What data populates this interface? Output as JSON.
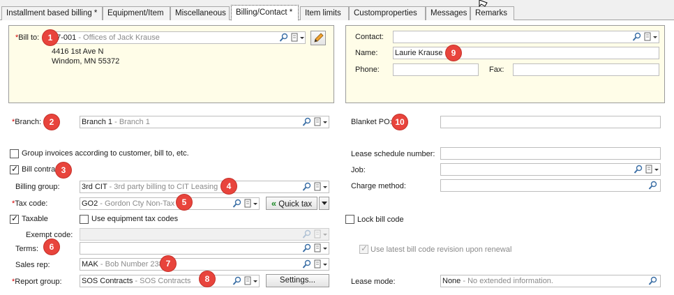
{
  "tabs": [
    {
      "label": "Installment based billing *"
    },
    {
      "label": "Equipment/Item"
    },
    {
      "label": "Miscellaneous"
    },
    {
      "label": "Billing/Contact *"
    },
    {
      "label": "Item limits"
    },
    {
      "label": "Customproperties"
    },
    {
      "label": "Messages"
    },
    {
      "label": "Remarks"
    }
  ],
  "bill_to": {
    "required_mark": "*",
    "label": "Bill to:",
    "code": "07-001",
    "separator": " - ",
    "desc": "Offices of Jack Krause",
    "address_line1": "4416 1st Ave N",
    "address_line2": "Windom, MN 55372"
  },
  "contact": {
    "contact_label": "Contact:",
    "contact_value": "",
    "name_label": "Name:",
    "name_value": "Laurie Krause",
    "phone_label": "Phone:",
    "phone_value": "",
    "fax_label": "Fax:",
    "fax_value": ""
  },
  "left": {
    "branch": {
      "req": "*",
      "label": "Branch:",
      "code": "Branch 1",
      "sep": " - ",
      "desc": "Branch 1"
    },
    "group_invoices": {
      "label": "Group invoices according to customer, bill to, etc.",
      "checked": false
    },
    "bill_contract": {
      "label": "Bill contract",
      "checked": true
    },
    "billing_group": {
      "label": "Billing group:",
      "code": "3rd CIT",
      "sep": " - ",
      "desc": "3rd party billing to CIT Leasing"
    },
    "tax_code": {
      "req": "*",
      "label": "Tax code:",
      "code": "GO2",
      "sep": " - ",
      "desc": "Gordon Cty Non-Tax"
    },
    "quick_tax": "Quick tax",
    "taxable": {
      "label": "Taxable",
      "checked": true
    },
    "use_equipment_tax": {
      "label": "Use equipment tax codes",
      "checked": false
    },
    "exempt_code": {
      "label": "Exempt code:"
    },
    "terms": {
      "label": "Terms:",
      "value": ""
    },
    "sales_rep": {
      "label": "Sales rep:",
      "code": "MAK",
      "sep": " - ",
      "desc": "Bob Number 238"
    },
    "report_group": {
      "req": "*",
      "label": "Report group:",
      "code": "SOS Contracts",
      "sep": " - ",
      "desc": "SOS Contracts"
    },
    "settings_button": "Settings..."
  },
  "right": {
    "blanket_po": {
      "label": "Blanket PO:",
      "value": ""
    },
    "lease_schedule": {
      "label": "Lease schedule number:",
      "value": ""
    },
    "job": {
      "label": "Job:",
      "value": ""
    },
    "charge_method": {
      "label": "Charge method:",
      "value": ""
    },
    "lock_bill_code": {
      "label": "Lock bill code",
      "checked": false
    },
    "use_latest": {
      "label": "Use latest bill code revision upon renewal",
      "checked": true
    },
    "lease_mode": {
      "label": "Lease mode:",
      "code": "None",
      "sep": " - ",
      "desc": "No extended information."
    }
  },
  "badges": [
    "1",
    "2",
    "3",
    "4",
    "5",
    "6",
    "7",
    "8",
    "9",
    "10"
  ],
  "colors": {
    "badge": "#e8443c",
    "panel": "#fffde8",
    "required": "#d40000",
    "quick_tax_arrow": "#1e8a2a"
  }
}
